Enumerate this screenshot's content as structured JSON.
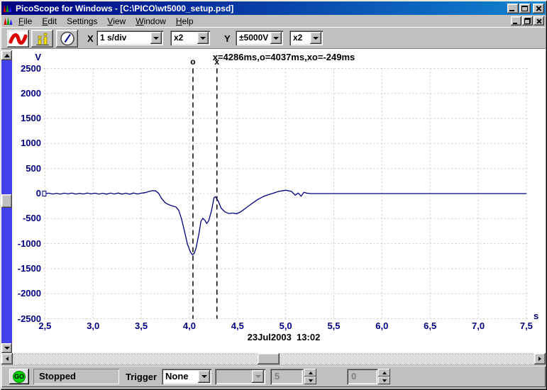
{
  "window": {
    "title": "PicoScope for Windows - [C:\\PICO\\wt5000_setup.psd]"
  },
  "icons": {
    "app_icon": "rgb-waveform-icon",
    "scope_button_icon": "red-sine-wave-icon",
    "spectrum_button_icon": "yellow-bars-spectrum-icon",
    "meter_button_icon": "gauge-needle-icon"
  },
  "menu": {
    "items": [
      {
        "label": "File",
        "underline": 0
      },
      {
        "label": "Edit",
        "underline": 0
      },
      {
        "label": "Settings",
        "underline": -1
      },
      {
        "label": "View",
        "underline": 0
      },
      {
        "label": "Window",
        "underline": 0
      },
      {
        "label": "Help",
        "underline": 0
      }
    ]
  },
  "toolbar": {
    "x_label": "X",
    "timebase": "1 s/div",
    "x_multiplier": "x2",
    "y_label": "Y",
    "y_range": "±5000V",
    "y_multiplier": "x2"
  },
  "chart_data": {
    "type": "line",
    "annotation": "x=4286ms,o=4037ms,xo=-249ms",
    "timestamp": "23Jul2003  13:02",
    "ylabel": "V",
    "xlabel": "s",
    "xlim": [
      2.5,
      7.5
    ],
    "ylim": [
      -2500,
      2500
    ],
    "grid": true,
    "x_ticks": [
      "2,5",
      "3,0",
      "3,5",
      "4,0",
      "4,5",
      "5,0",
      "5,5",
      "6,0",
      "6,5",
      "7,0",
      "7,5"
    ],
    "x_tick_values": [
      2.5,
      3.0,
      3.5,
      4.0,
      4.5,
      5.0,
      5.5,
      6.0,
      6.5,
      7.0,
      7.5
    ],
    "y_ticks": [
      "2500",
      "2000",
      "1500",
      "1000",
      "500",
      "0",
      "-500",
      "-1000",
      "-1500",
      "-2000",
      "-2500"
    ],
    "y_tick_values": [
      2500,
      2000,
      1500,
      1000,
      500,
      0,
      -500,
      -1000,
      -1500,
      -2000,
      -2500
    ],
    "cursors": [
      {
        "label": "o",
        "time_s": 4.037
      },
      {
        "label": "x",
        "time_s": 4.286
      }
    ],
    "series": [
      {
        "name": "channel-trace",
        "color": "#000080",
        "points": [
          [
            2.5,
            0
          ],
          [
            2.54,
            8
          ],
          [
            2.58,
            -8
          ],
          [
            2.62,
            5
          ],
          [
            2.66,
            -10
          ],
          [
            2.7,
            8
          ],
          [
            2.74,
            -6
          ],
          [
            2.78,
            10
          ],
          [
            2.82,
            -10
          ],
          [
            2.86,
            6
          ],
          [
            2.9,
            -9
          ],
          [
            2.94,
            10
          ],
          [
            2.98,
            -6
          ],
          [
            3.02,
            9
          ],
          [
            3.06,
            -10
          ],
          [
            3.1,
            7
          ],
          [
            3.14,
            -12
          ],
          [
            3.18,
            10
          ],
          [
            3.22,
            -9
          ],
          [
            3.26,
            12
          ],
          [
            3.3,
            -11
          ],
          [
            3.34,
            9
          ],
          [
            3.38,
            -14
          ],
          [
            3.42,
            11
          ],
          [
            3.46,
            -9
          ],
          [
            3.5,
            8
          ],
          [
            3.54,
            18
          ],
          [
            3.58,
            42
          ],
          [
            3.62,
            60
          ],
          [
            3.65,
            52
          ],
          [
            3.68,
            8
          ],
          [
            3.71,
            -95
          ],
          [
            3.75,
            -185
          ],
          [
            3.79,
            -225
          ],
          [
            3.83,
            -250
          ],
          [
            3.86,
            -268
          ],
          [
            3.89,
            -335
          ],
          [
            3.92,
            -520
          ],
          [
            3.95,
            -760
          ],
          [
            3.98,
            -1010
          ],
          [
            4.01,
            -1165
          ],
          [
            4.03,
            -1220
          ],
          [
            4.05,
            -1195
          ],
          [
            4.07,
            -1085
          ],
          [
            4.1,
            -795
          ],
          [
            4.12,
            -555
          ],
          [
            4.14,
            -495
          ],
          [
            4.16,
            -532
          ],
          [
            4.18,
            -598
          ],
          [
            4.2,
            -545
          ],
          [
            4.23,
            -335
          ],
          [
            4.255,
            -85
          ],
          [
            4.27,
            -62
          ],
          [
            4.3,
            -152
          ],
          [
            4.33,
            -292
          ],
          [
            4.37,
            -368
          ],
          [
            4.41,
            -398
          ],
          [
            4.45,
            -388
          ],
          [
            4.49,
            -402
          ],
          [
            4.53,
            -368
          ],
          [
            4.58,
            -298
          ],
          [
            4.64,
            -212
          ],
          [
            4.71,
            -118
          ],
          [
            4.78,
            -48
          ],
          [
            4.86,
            2
          ],
          [
            4.93,
            46
          ],
          [
            5.0,
            66
          ],
          [
            5.06,
            44
          ],
          [
            5.1,
            -32
          ],
          [
            5.13,
            12
          ],
          [
            5.16,
            -52
          ],
          [
            5.19,
            26
          ],
          [
            5.22,
            8
          ],
          [
            5.26,
            0
          ],
          [
            5.4,
            0
          ],
          [
            5.6,
            0
          ],
          [
            5.8,
            0
          ],
          [
            6.0,
            0
          ],
          [
            6.25,
            0
          ],
          [
            6.5,
            0
          ],
          [
            6.75,
            0
          ],
          [
            7.0,
            0
          ],
          [
            7.25,
            0
          ],
          [
            7.5,
            0
          ]
        ]
      }
    ]
  },
  "status_bar": {
    "go_label": "GO",
    "status_text": "Stopped",
    "trigger_label": "Trigger",
    "trigger_mode": "None",
    "spinbox1_value": "5",
    "spinbox2_value": "0"
  },
  "colors": {
    "title_gradient_left": "#000080",
    "title_gradient_right": "#1084d0",
    "waveform": "#000080",
    "axis_text": "#000080",
    "scrollbar_track_blue": "#4343ee",
    "go_button_green": "#00d800",
    "window_chrome": "#c0c0c0"
  }
}
